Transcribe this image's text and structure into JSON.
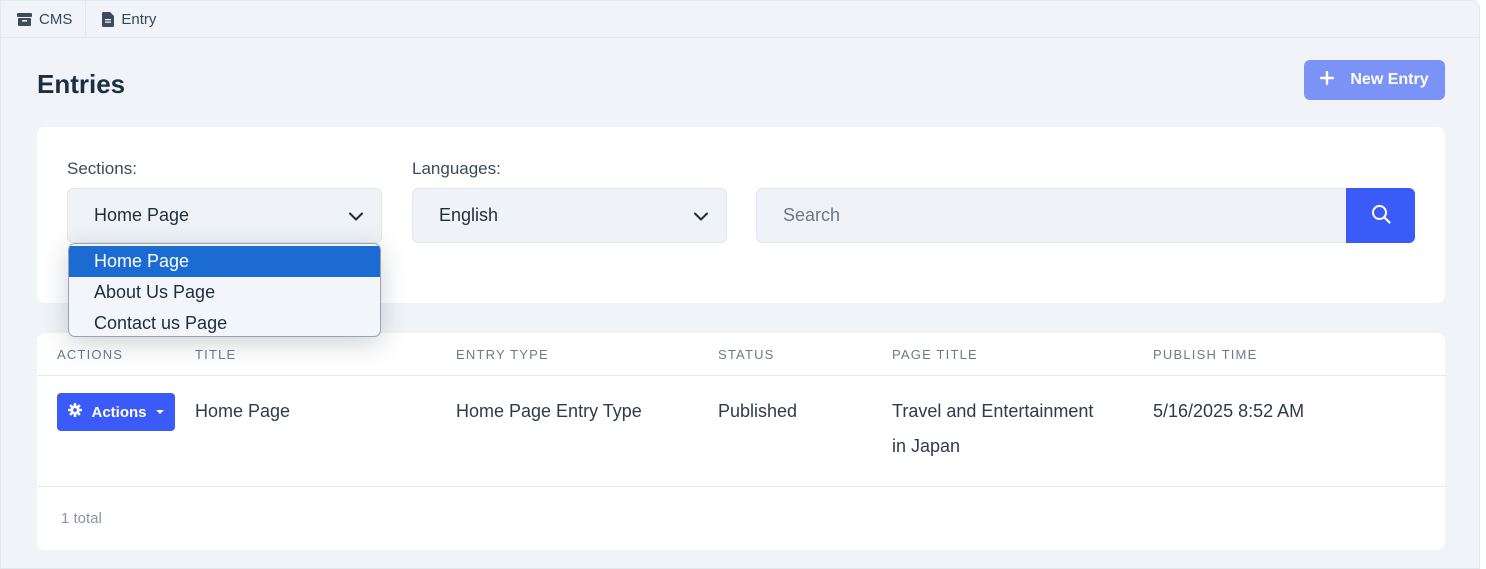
{
  "breadcrumb": [
    {
      "label": "CMS",
      "icon": "archive-icon"
    },
    {
      "label": "Entry",
      "icon": "document-icon"
    }
  ],
  "page": {
    "title": "Entries"
  },
  "new_entry_button": {
    "label": "New Entry",
    "icon": "plus-icon"
  },
  "filters": {
    "sections_label": "Sections:",
    "sections_value": "Home Page",
    "languages_label": "Languages:",
    "languages_value": "English",
    "search_placeholder": "Search"
  },
  "section_dropdown": {
    "options": [
      "Home Page",
      "About Us Page",
      "Contact us Page"
    ],
    "highlighted": "Home Page"
  },
  "table": {
    "columns": [
      "ACTIONS",
      "TITLE",
      "ENTRY TYPE",
      "STATUS",
      "PAGE TITLE",
      "PUBLISH TIME"
    ],
    "rows": [
      {
        "actions_label": "Actions",
        "title": "Home Page",
        "entry_type": "Home Page Entry Type",
        "status": "Published",
        "page_title_line1": "Travel and Entertainment",
        "page_title_line2": "in Japan",
        "publish_time": "5/16/2025 8:52 AM"
      }
    ],
    "total": "1 total"
  },
  "colors": {
    "accent": "#3a5bf7",
    "accent_disabled": "#7b93f6",
    "selected_option": "#1b6bd3",
    "background": "#f0f4f8"
  }
}
